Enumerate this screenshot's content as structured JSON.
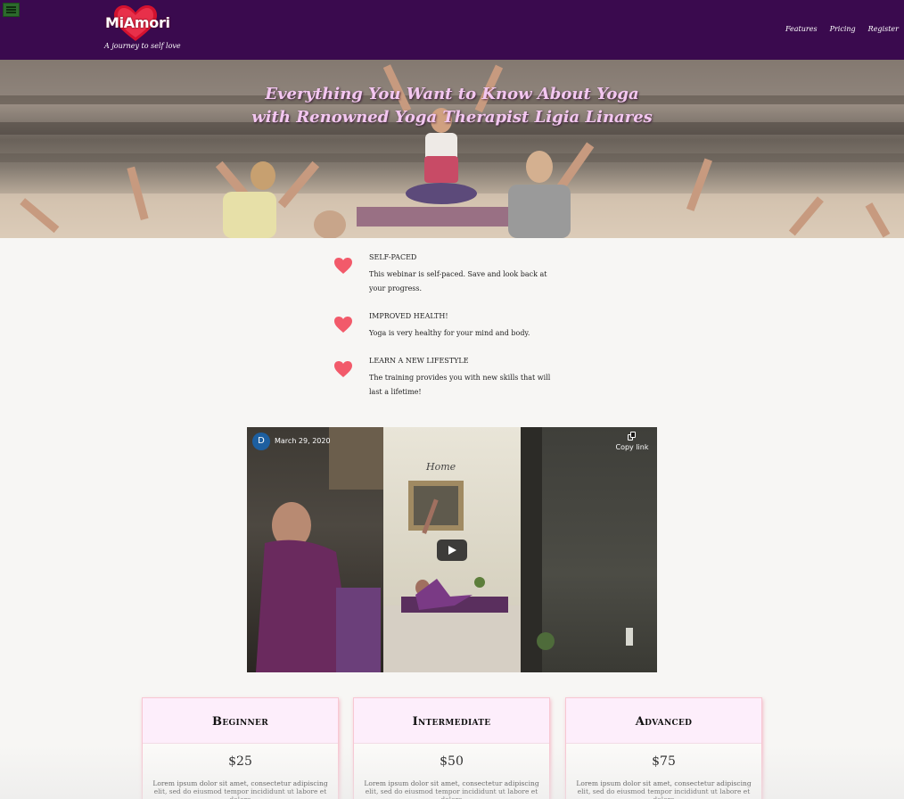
{
  "nav": {
    "menu_icon": "hamburger-menu-icon",
    "brand": "MiAmori",
    "tagline": "A journey to self love",
    "links": [
      "Features",
      "Pricing",
      "Register"
    ],
    "brand_color": "#3a0a4e"
  },
  "hero": {
    "title_line1": "Everything You Want to Know About Yoga",
    "title_line2": "with Renowned Yoga Therapist Ligia Linares",
    "title_color": "#f3c7f0"
  },
  "features": [
    {
      "icon": "heart-icon",
      "title": "SELF-PACED",
      "description": "This webinar is self-paced. Save and look back at your progress."
    },
    {
      "icon": "heart-icon",
      "title": "IMPROVED HEALTH!",
      "description": "Yoga is very healthy for your mind and body."
    },
    {
      "icon": "heart-icon",
      "title": "LEARN A NEW LIFESTYLE",
      "description": "The training provides you with new skills that will last a lifetime!"
    }
  ],
  "video": {
    "avatar_letter": "D",
    "date": "March 29, 2020",
    "copy_label": "Copy link",
    "play_icon": "play-icon"
  },
  "pricing": [
    {
      "name": "Beginner",
      "price": "$25",
      "text": "Lorem ipsum dolor sit amet, consectetur adipiscing elit, sed do eiusmod tempor incididunt ut labore et dolore"
    },
    {
      "name": "Intermediate",
      "price": "$50",
      "text": "Lorem ipsum dolor sit amet, consectetur adipiscing elit, sed do eiusmod tempor incididunt ut labore et dolore"
    },
    {
      "name": "Advanced",
      "price": "$75",
      "text": "Lorem ipsum dolor sit amet, consectetur adipiscing elit, sed do eiusmod tempor incididunt ut labore et dolore"
    }
  ],
  "accent_color": "#f25a6a"
}
